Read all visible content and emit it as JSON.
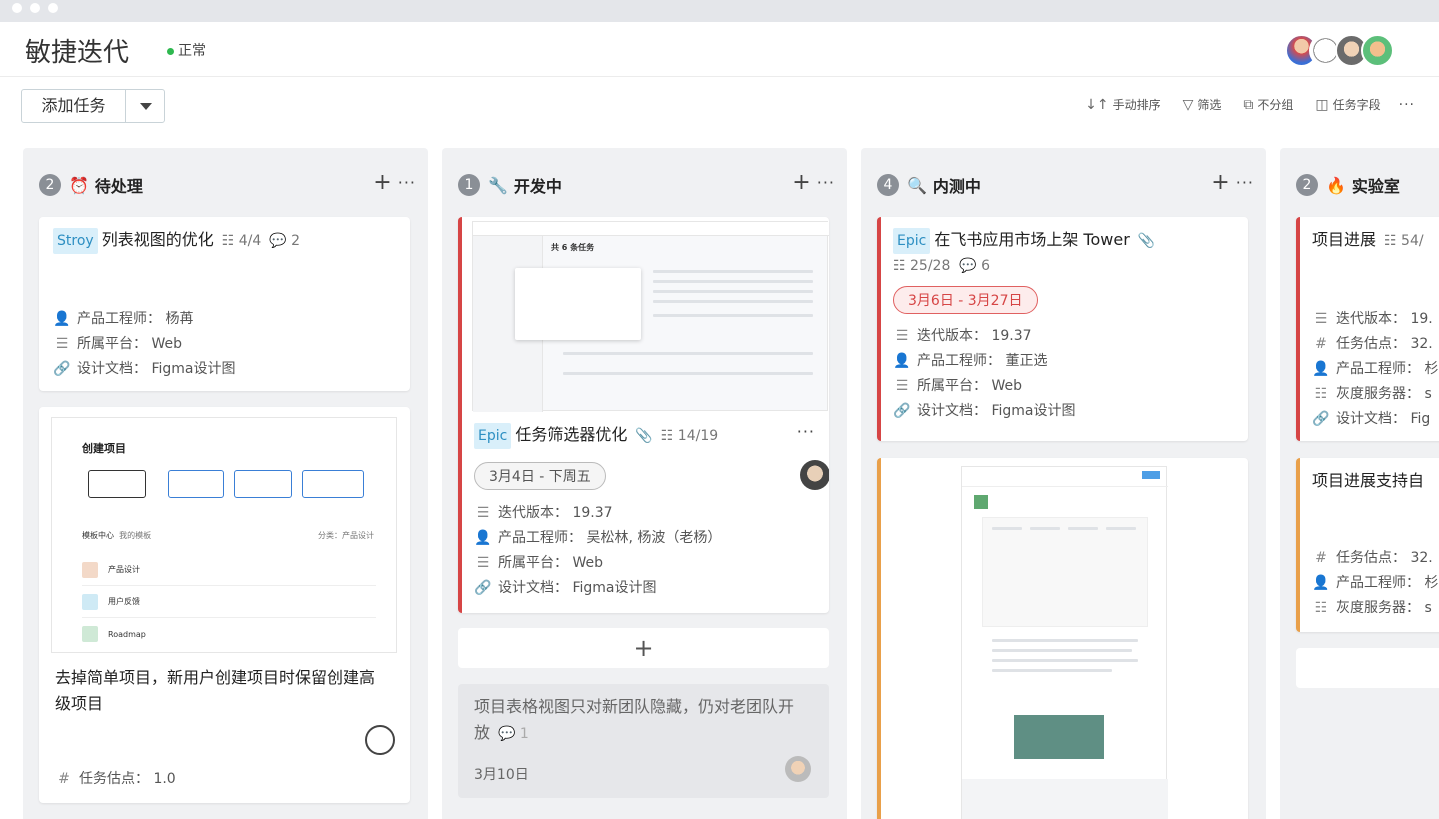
{
  "page": {
    "title": "敏捷迭代",
    "status": "正常"
  },
  "toolbar": {
    "add_label": "添加任务",
    "tools": [
      {
        "icon": "sort-icon",
        "label": "手动排序"
      },
      {
        "icon": "filter-icon",
        "label": "筛选"
      },
      {
        "icon": "group-icon",
        "label": "不分组"
      },
      {
        "icon": "fields-icon",
        "label": "任务字段"
      }
    ],
    "more": "···"
  },
  "columns": [
    {
      "count": "2",
      "emoji": "⏰",
      "title": "待处理"
    },
    {
      "count": "1",
      "emoji": "🔧",
      "title": "开发中"
    },
    {
      "count": "4",
      "emoji": "🔍",
      "title": "内测中"
    },
    {
      "count": "2",
      "emoji": "🔥",
      "title": "实验室"
    }
  ],
  "cards": {
    "c1": {
      "tag": "Stroy",
      "title": "列表视图的优化",
      "subtasks": "4/4",
      "comments": "2",
      "fields": [
        "产品工程师： 杨苒",
        "所属平台： Web",
        "设计文档： Figma设计图"
      ]
    },
    "c2": {
      "shot_title": "创建项目",
      "shot_tabs": [
        "模板中心",
        "我的模板"
      ],
      "shot_sort": "分类：产品设计",
      "shot_items": [
        "产品设计",
        "用户反馈",
        "Roadmap"
      ],
      "title": "去掉简单项目，新用户创建项目时保留创建高级项目",
      "fields": [
        "任务估点： 1.0"
      ]
    },
    "c3": {
      "tag": "Epic",
      "title": "任务筛选器优化",
      "subtasks": "14/19",
      "date": "3月4日 - 下周五",
      "fields": [
        "迭代版本： 19.37",
        "产品工程师： 吴松林, 杨波（老杨）",
        "所属平台： Web",
        "设计文档： Figma设计图"
      ],
      "shot_header": "共 6 条任务"
    },
    "c4": {
      "title": "项目表格视图只对新团队隐藏，仍对老团队开放",
      "comments": "1",
      "date": "3月10日"
    },
    "c5": {
      "tag": "Epic",
      "title": "在飞书应用市场上架 Tower",
      "subtasks": "25/28",
      "comments": "6",
      "date": "3月6日 - 3月27日",
      "fields": [
        "迭代版本： 19.37",
        "产品工程师： 董正选",
        "所属平台： Web",
        "设计文档： Figma设计图"
      ]
    },
    "c7": {
      "title": "项目进展",
      "subtasks": "54/",
      "fields": [
        "迭代版本： 19.",
        "任务估点： 32.",
        "产品工程师： 杉",
        "灰度服务器： s",
        "设计文档： Fig"
      ]
    },
    "c8": {
      "title": "项目进展支持自",
      "fields": [
        "任务估点： 32.",
        "产品工程师： 杉",
        "灰度服务器： s"
      ]
    }
  },
  "add_card": "+"
}
